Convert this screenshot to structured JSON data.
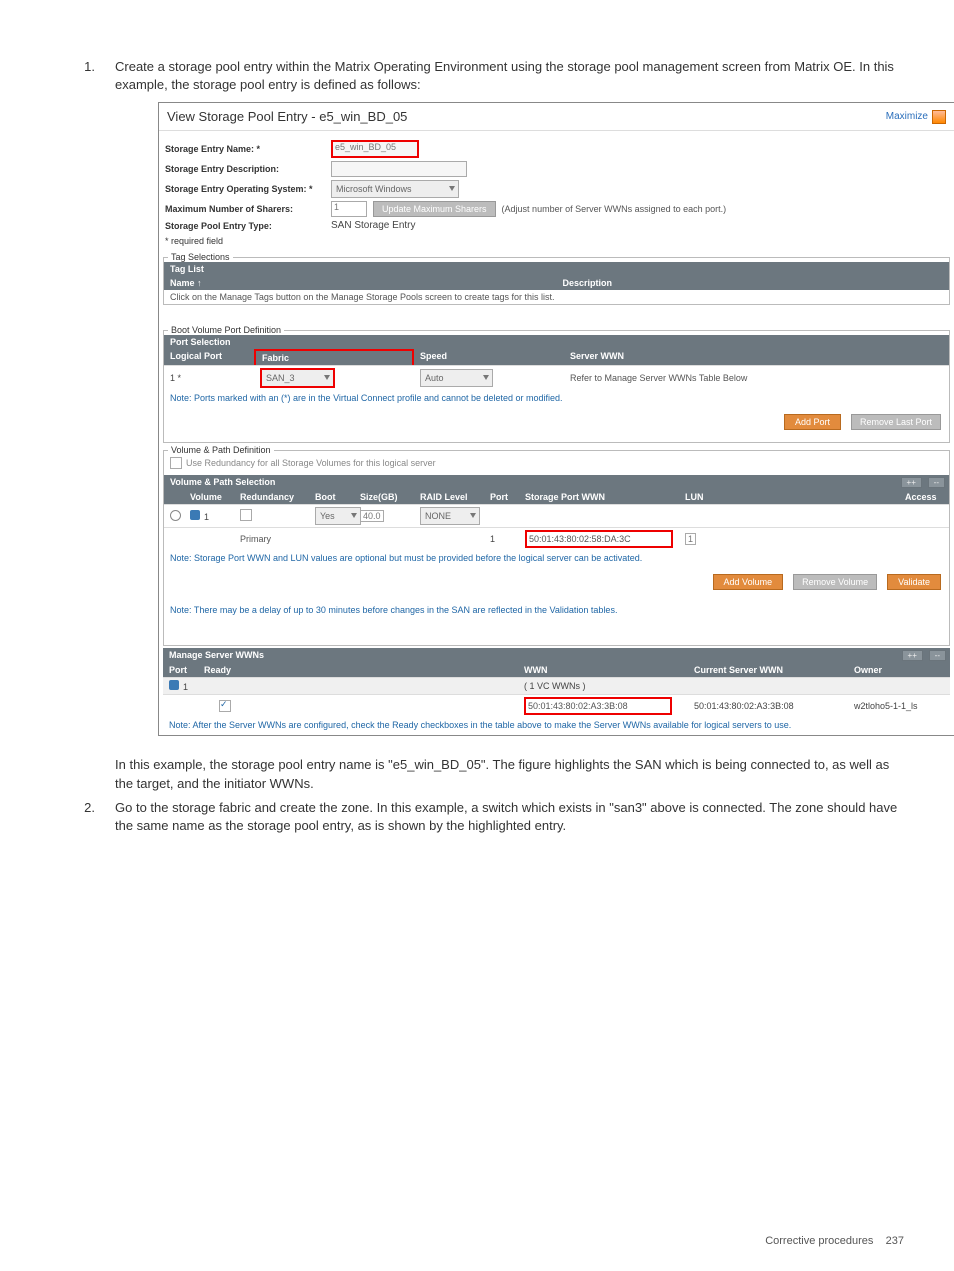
{
  "page": {
    "step1_num": "1.",
    "step1_text": "Create a storage pool entry within the Matrix Operating Environment using the storage pool management screen from Matrix OE. In this example, the storage pool entry is defined as follows:",
    "mid_para": "In this example, the storage pool entry name is \"e5_win_BD_05\". The figure highlights the SAN which is being connected to, as well as the target, and the initiator WWNs.",
    "step2_num": "2.",
    "step2_text": "Go to the storage fabric and create the zone. In this example, a switch which exists in \"san3\" above is connected. The zone should have the same name as the storage pool entry, as is shown by the highlighted entry.",
    "footer_label": "Corrective procedures",
    "footer_page": "237"
  },
  "dlg": {
    "title": "View Storage Pool Entry - e5_win_BD_05",
    "maximize": "Maximize",
    "labels": {
      "name": "Storage Entry Name: *",
      "desc": "Storage Entry Description:",
      "os": "Storage Entry Operating System: *",
      "maxshare": "Maximum Number of Sharers:",
      "type": "Storage Pool Entry Type:"
    },
    "values": {
      "name": "e5_win_BD_05",
      "os": "Microsoft Windows",
      "maxshare": "1",
      "type": "SAN Storage Entry"
    },
    "btn_update": "Update Maximum Sharers",
    "hint_adjust": "(Adjust number of Server WWNs assigned to each port.)",
    "required_field": "* required field",
    "tag_selections": "Tag Selections",
    "tag_list": "Tag List",
    "th_name": "Name",
    "th_desc": "Description",
    "tag_note": "Click on the Manage Tags button on the Manage Storage Pools screen to create tags for this list.",
    "boot_port_def": "Boot Volume Port Definition",
    "port_selection": "Port Selection",
    "th_logical_port": "Logical Port",
    "th_fabric": "Fabric",
    "th_speed": "Speed",
    "th_server_wwn": "Server WWN",
    "row_port": "1 *",
    "row_fabric": "SAN_3",
    "row_speed": "Auto",
    "row_wwn": "Refer to Manage Server WWNs Table Below",
    "port_note": "Note: Ports marked with an (*) are in the Virtual Connect profile and cannot be deleted or modified.",
    "btn_add_port": "Add Port",
    "btn_remove_port": "Remove Last Port",
    "vol_path_def": "Volume & Path Definition",
    "cb_redundancy": "Use Redundancy for all Storage Volumes for this logical server",
    "vol_path_sel": "Volume & Path Selection",
    "vth": {
      "vol": "Volume",
      "red": "Redundancy",
      "boot": "Boot",
      "size": "Size(GB)",
      "raid": "RAID Level",
      "port": "Port",
      "spwwn": "Storage Port WWN",
      "lun": "LUN",
      "access": "Access"
    },
    "vrow": {
      "vol": "1",
      "boot": "Yes",
      "size": "40.0",
      "raid": "NONE",
      "port": "1",
      "primary": "Primary",
      "spwwn": "50:01:43:80:02:58:DA:3C",
      "lun": "1"
    },
    "vnote1": "Note: Storage Port WWN and LUN values are optional but must be provided before the logical server can be activated.",
    "btn_add_vol": "Add Volume",
    "btn_remove_vol": "Remove Volume",
    "btn_validate": "Validate",
    "vnote2": "Note: There may be a delay of up to 30 minutes before changes in the SAN are reflected in the Validation tables.",
    "mgr_title": "Manage Server WWNs",
    "mth": {
      "port": "Port",
      "ready": "Ready",
      "wwn": "WWN",
      "cur": "Current Server WWN",
      "owner": "Owner"
    },
    "mrow": {
      "port": "1",
      "wwns_count": "( 1 VC WWNs )",
      "wwn": "50:01:43:80:02:A3:3B:08",
      "cur": "50:01:43:80:02:A3:3B:08",
      "owner": "w2tloho5-1-1_ls"
    },
    "mnote": "Note: After the Server WWNs are configured, check the Ready checkboxes in the table above to make the Server WWNs available for logical servers to use.",
    "btn_plus": "++",
    "btn_minus": "--"
  }
}
